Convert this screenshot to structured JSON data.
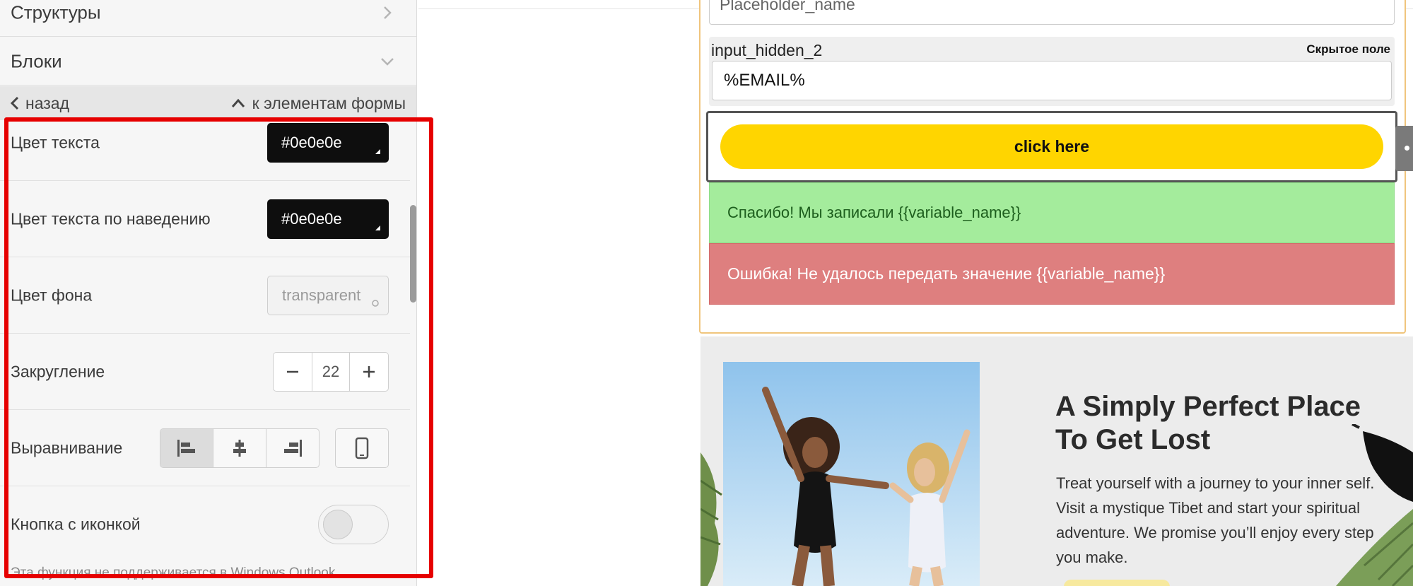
{
  "left_panel": {
    "accordion": {
      "structures": "Структуры",
      "blocks": "Блоки"
    },
    "nav": {
      "back": "назад",
      "to_form_elements": "к элементам формы"
    },
    "rows": {
      "text_color": {
        "label": "Цвет текста",
        "value": "#0e0e0e"
      },
      "hover_text_color": {
        "label": "Цвет текста по наведению",
        "value": "#0e0e0e"
      },
      "bg_color": {
        "label": "Цвет фона",
        "value": "transparent"
      },
      "rounding": {
        "label": "Закругление",
        "value": "22"
      },
      "alignment": {
        "label": "Выравнивание"
      },
      "icon_button": {
        "label": "Кнопка с иконкой",
        "enabled": false
      },
      "note": "Эта функция не поддерживается в Windows Outlook"
    }
  },
  "form": {
    "placeholder_value": "Placeholder_name",
    "hidden_field": {
      "name": "input_hidden_2",
      "tag": "Скрытое поле",
      "value": "%EMAIL%"
    },
    "button_label": "click here",
    "success_message": "Спасибо! Мы записали {{variable_name}}",
    "error_message": "Ошибка! Не удалось передать значение {{variable_name}}"
  },
  "hero": {
    "title": "A Simply Perfect Place To Get Lost",
    "text": "Treat yourself with a journey to your inner self. Visit a mystique Tibet and start your spiritual adventure. We promise you’ll enjoy every step you make."
  },
  "colors": {
    "highlight": "#e60000",
    "button": "#ffd500",
    "success_bg": "#a4ec9c",
    "error_bg": "#de7f7f",
    "form_border": "#f0c57d"
  }
}
